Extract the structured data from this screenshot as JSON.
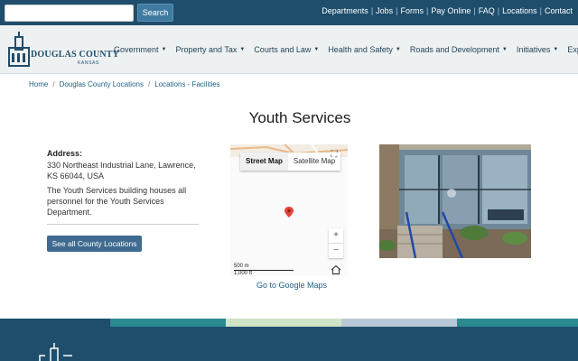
{
  "search": {
    "placeholder": "",
    "button_label": "Search"
  },
  "utility_links": [
    "Departments",
    "Jobs",
    "Forms",
    "Pay Online",
    "FAQ",
    "Locations",
    "Contact"
  ],
  "logo": {
    "name": "DOUGLAS COUNTY",
    "state": "KANSAS"
  },
  "nav": [
    "Government",
    "Property and Tax",
    "Courts and Law",
    "Health and Safety",
    "Roads and Development",
    "Initiatives",
    "Explore"
  ],
  "breadcrumb": [
    "Home",
    "Douglas County Locations",
    "Locations - Facilities"
  ],
  "page": {
    "title": "Youth Services",
    "address_label": "Address:",
    "address": "330 Northeast Industrial Lane, Lawrence, KS 66044, USA",
    "description": "The Youth Services building houses all personnel for the Youth Services Department.",
    "button_label": "See all County Locations"
  },
  "map": {
    "tabs": [
      "Street Map",
      "Satellite Map"
    ],
    "active_tab": "Street Map",
    "zoom_in": "+",
    "zoom_out": "−",
    "scale_metric": "500 m",
    "scale_imperial": "1,000 ft",
    "google_link": "Go to Google Maps"
  },
  "colors": {
    "topbar": "#1f4e6c",
    "button": "#3e6b8f",
    "link": "#1f5f85",
    "stripes": [
      "#1f4e6c",
      "#2a8a8f",
      "#cfe3c5",
      "#b9c8d6",
      "#2a8a8f"
    ]
  },
  "icons": [
    "fullscreen-icon",
    "map-pin-icon",
    "home-icon",
    "caret-down-icon"
  ]
}
